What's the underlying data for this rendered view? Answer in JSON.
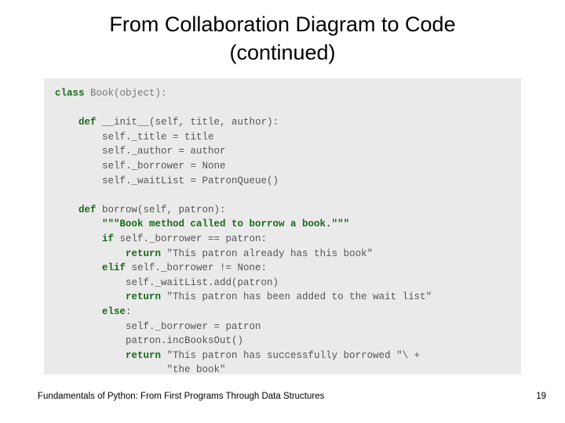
{
  "slide": {
    "title_line1": "From Collaboration Diagram to Code",
    "title_line2": "(continued)",
    "footer": "Fundamentals of Python: From First Programs Through Data Structures",
    "page_number": "19",
    "code_background": "#eaeaea",
    "keyword_color": "#1a6b1a",
    "text_color": "#555555",
    "code_lines": [
      {
        "id": "l1",
        "segments": [
          {
            "t": "class ",
            "k": "kw"
          },
          {
            "t": "Book(object):",
            "k": "cls"
          }
        ]
      },
      {
        "id": "l2",
        "segments": []
      },
      {
        "id": "l3",
        "segments": [
          {
            "t": "    ",
            "k": "plain"
          },
          {
            "t": "def ",
            "k": "kw"
          },
          {
            "t": "__init__(self, title, author):",
            "k": "plain"
          }
        ]
      },
      {
        "id": "l4",
        "segments": [
          {
            "t": "        self._title = title",
            "k": "plain"
          }
        ]
      },
      {
        "id": "l5",
        "segments": [
          {
            "t": "        self._author = author",
            "k": "plain"
          }
        ]
      },
      {
        "id": "l6",
        "segments": [
          {
            "t": "        self._borrower = None",
            "k": "plain"
          }
        ]
      },
      {
        "id": "l7",
        "segments": [
          {
            "t": "        self._waitList = PatronQueue()",
            "k": "plain"
          }
        ]
      },
      {
        "id": "l8",
        "segments": []
      },
      {
        "id": "l9",
        "segments": [
          {
            "t": "    ",
            "k": "plain"
          },
          {
            "t": "def ",
            "k": "kw"
          },
          {
            "t": "borrow(self, patron):",
            "k": "plain"
          }
        ]
      },
      {
        "id": "l10",
        "segments": [
          {
            "t": "        ",
            "k": "plain"
          },
          {
            "t": "\"\"\"Book method called to borrow a book.\"\"\"",
            "k": "dstr"
          }
        ]
      },
      {
        "id": "l11",
        "segments": [
          {
            "t": "        ",
            "k": "plain"
          },
          {
            "t": "if ",
            "k": "kw"
          },
          {
            "t": "self._borrower == patron:",
            "k": "plain"
          }
        ]
      },
      {
        "id": "l12",
        "segments": [
          {
            "t": "            ",
            "k": "plain"
          },
          {
            "t": "return ",
            "k": "kw"
          },
          {
            "t": "\"This patron already has this book\"",
            "k": "plain"
          }
        ]
      },
      {
        "id": "l13",
        "segments": [
          {
            "t": "        ",
            "k": "plain"
          },
          {
            "t": "elif ",
            "k": "kw"
          },
          {
            "t": "self._borrower != None:",
            "k": "plain"
          }
        ]
      },
      {
        "id": "l14",
        "segments": [
          {
            "t": "            self._waitList.add(patron)",
            "k": "plain"
          }
        ]
      },
      {
        "id": "l15",
        "segments": [
          {
            "t": "            ",
            "k": "plain"
          },
          {
            "t": "return ",
            "k": "kw"
          },
          {
            "t": "\"This patron has been added to the wait list\"",
            "k": "plain"
          }
        ]
      },
      {
        "id": "l16",
        "segments": [
          {
            "t": "        ",
            "k": "plain"
          },
          {
            "t": "else",
            "k": "kw"
          },
          {
            "t": ":",
            "k": "plain"
          }
        ]
      },
      {
        "id": "l17",
        "segments": [
          {
            "t": "            self._borrower = patron",
            "k": "plain"
          }
        ]
      },
      {
        "id": "l18",
        "segments": [
          {
            "t": "            patron.incBooksOut()",
            "k": "plain"
          }
        ]
      },
      {
        "id": "l19",
        "segments": [
          {
            "t": "            ",
            "k": "plain"
          },
          {
            "t": "return ",
            "k": "kw"
          },
          {
            "t": "\"This patron has successfully borrowed \"\\ +",
            "k": "plain"
          }
        ]
      },
      {
        "id": "l20",
        "segments": [
          {
            "t": "                   \"the book\"",
            "k": "plain"
          }
        ]
      }
    ]
  }
}
